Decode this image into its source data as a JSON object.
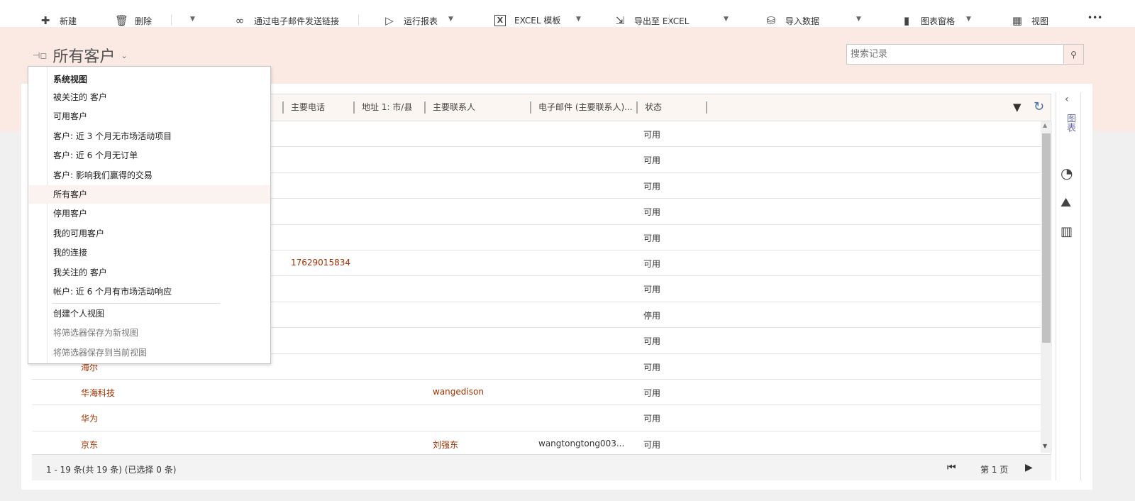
{
  "toolbar": {
    "new": "新建",
    "delete": "删除",
    "email_link": "通过电子邮件发送链接",
    "run_report": "运行报表",
    "excel_template": "EXCEL 模板",
    "export_excel": "导出至 EXCEL",
    "import_data": "导入数据",
    "chart_pane": "图表窗格",
    "view": "视图",
    "more": "•••"
  },
  "header": {
    "title": "所有客户",
    "search_placeholder": "搜索记录"
  },
  "columns": [
    "主要电话",
    "地址 1: 市/县",
    "主要联系人",
    "电子邮件 (主要联系人)...",
    "状态"
  ],
  "rows": [
    {
      "name": "",
      "phone": "",
      "contact": "",
      "email": "",
      "status": "可用"
    },
    {
      "name": "",
      "phone": "",
      "contact": "",
      "email": "",
      "status": "可用"
    },
    {
      "name": "",
      "phone": "",
      "contact": "",
      "email": "",
      "status": "可用"
    },
    {
      "name": "",
      "phone": "",
      "contact": "",
      "email": "",
      "status": "可用"
    },
    {
      "name": "",
      "phone": "",
      "contact": "",
      "email": "",
      "status": "可用"
    },
    {
      "name": "",
      "phone": "17629015834",
      "contact": "",
      "email": "",
      "status": "可用"
    },
    {
      "name": "",
      "phone": "",
      "contact": "",
      "email": "",
      "status": "可用"
    },
    {
      "name": "",
      "phone": "",
      "contact": "",
      "email": "",
      "status": "停用"
    },
    {
      "name": "",
      "phone": "",
      "contact": "",
      "email": "",
      "status": "可用"
    },
    {
      "name": "海尔",
      "phone": "",
      "contact": "",
      "email": "",
      "status": "可用"
    },
    {
      "name": "华海科技",
      "phone": "",
      "contact": "wangedison",
      "email": "",
      "status": "可用"
    },
    {
      "name": "华为",
      "phone": "",
      "contact": "",
      "email": "",
      "status": "可用"
    },
    {
      "name": "京东",
      "phone": "",
      "contact": "刘强东",
      "email": "wangtongtong003...",
      "status": "可用"
    }
  ],
  "footer": {
    "count": "1 - 19  条(共 19 条) (已选择 0 条)",
    "page": "第 1 页"
  },
  "side": {
    "label": "图表"
  },
  "menu": {
    "header": "系统视图",
    "items": [
      "被关注的 客户",
      "可用客户",
      "客户: 近 3 个月无市场活动项目",
      "客户: 近 6 个月无订单",
      "客户: 影响我们赢得的交易",
      "所有客户",
      "停用客户",
      "我的可用客户",
      "我的连接",
      "我关注的 客户",
      "帐户: 近 6 个月有市场活动响应"
    ],
    "selected": "所有客户",
    "actions": [
      "创建个人视图",
      "将筛选器保存为新视图",
      "将筛选器保存到当前视图"
    ]
  }
}
